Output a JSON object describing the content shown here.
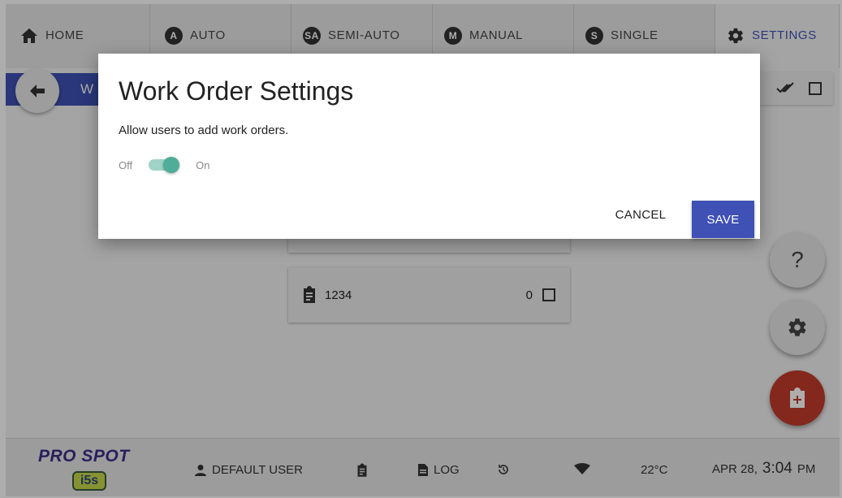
{
  "tabs": [
    {
      "label": "HOME",
      "icon": "home-icon"
    },
    {
      "label": "AUTO",
      "badge": "A"
    },
    {
      "label": "SEMI-AUTO",
      "badge": "SA"
    },
    {
      "label": "MANUAL",
      "badge": "M"
    },
    {
      "label": "SINGLE",
      "badge": "S"
    },
    {
      "label": "SETTINGS",
      "icon": "gear-icon",
      "active": true
    }
  ],
  "subheader": {
    "title": "W"
  },
  "cards": [
    {
      "label": "1234",
      "count": "0"
    }
  ],
  "fabs": {
    "help_label": "?"
  },
  "footer": {
    "logo_text": "PRO SPOT",
    "logo_badge": "i5s",
    "user": "DEFAULT USER",
    "log": "LOG",
    "temperature": "22°C",
    "date": "APR 28,",
    "time": "3:04",
    "ampm": "PM"
  },
  "dialog": {
    "title": "Work Order Settings",
    "description": "Allow users to add work orders.",
    "toggle_off_label": "Off",
    "toggle_on_label": "On",
    "toggle_value": true,
    "cancel_label": "CANCEL",
    "save_label": "SAVE"
  },
  "colors": {
    "primary": "#3f51b5",
    "accent_red": "#c33a2b",
    "toggle_on": "#4fae98"
  }
}
